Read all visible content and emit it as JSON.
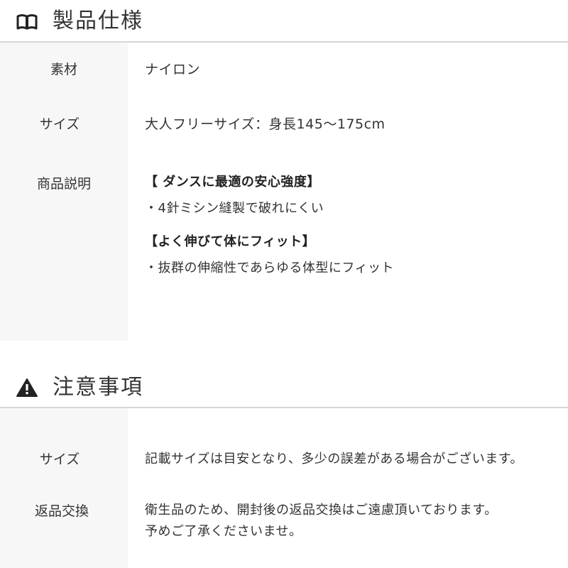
{
  "spec_section": {
    "icon": "book-icon",
    "title": "製品仕様",
    "rows": {
      "material": {
        "label": "素材",
        "value": "ナイロン"
      },
      "size": {
        "label": "サイズ",
        "value": "大人フリーサイズ：身長145〜175cm"
      },
      "description": {
        "label": "商品説明",
        "heading1": "【 ダンスに最適の安心強度】",
        "bullet1": "・4針ミシン縫製で破れにくい",
        "heading2": "【よく伸びて体にフィット】",
        "bullet2": "・抜群の伸縮性であらゆる体型にフィット"
      }
    }
  },
  "caution_section": {
    "icon": "warning-icon",
    "title": "注意事項",
    "rows": {
      "size": {
        "label": "サイズ",
        "value": "記載サイズは目安となり、多少の誤差がある場合がございます。"
      },
      "returns": {
        "label": "返品交換",
        "line1": "衛生品のため、開封後の返品交換はご遠慮頂いております。",
        "line2": "予めご了承くださいませ。"
      }
    }
  },
  "colors": {
    "text": "#333333",
    "label_background": "#f7f7f7",
    "rule": "#d6d6d6"
  }
}
